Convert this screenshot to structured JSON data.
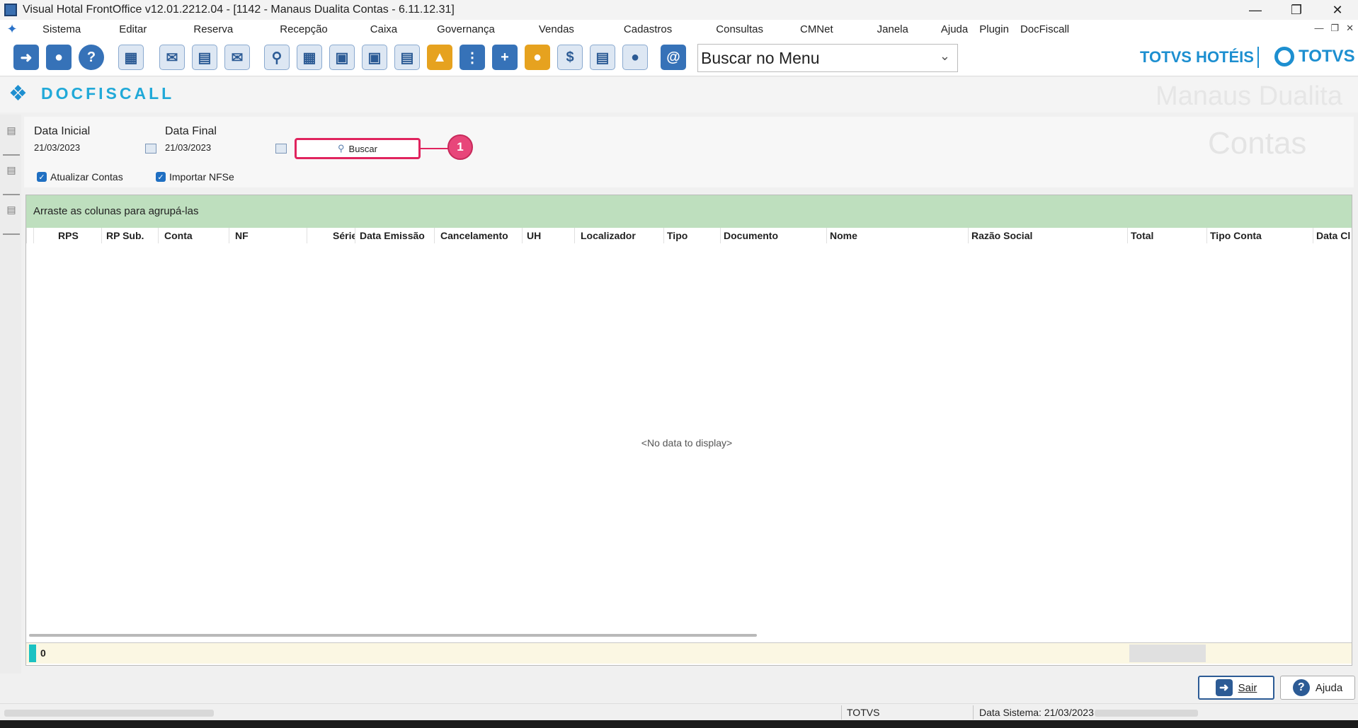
{
  "window": {
    "title": "Visual Hotal FrontOffice v12.01.2212.04 - [1142 - Manaus Dualita Contas - 6.11.12.31]"
  },
  "menu": [
    "Sistema",
    "Editar",
    "Reserva",
    "Recepção",
    "Caixa",
    "Governança",
    "Vendas",
    "Cadastros",
    "Consultas",
    "CMNet",
    "Janela",
    "Ajuda",
    "Plugin",
    "DocFiscall"
  ],
  "toolbar": {
    "search_placeholder": "Buscar no Menu",
    "brand_hoteis": "TOTVS HOTÉIS",
    "brand_totvs": "TOTVS",
    "icons": [
      "exit-icon",
      "user-key-icon",
      "help-icon",
      "network-icon",
      "mail-icon",
      "checklist-icon",
      "send-mail-icon",
      "search-icon",
      "calendar-icon",
      "guest-card-icon",
      "room-card-icon",
      "report-user-icon",
      "bell-icon",
      "footsteps-icon",
      "add-guest-icon",
      "housekeeping-icon",
      "cash-icon",
      "printer-icon",
      "concierge-icon",
      "email-at-icon"
    ]
  },
  "header": {
    "module": "DOCFISCALL",
    "watermark_top": "Manaus Dualita",
    "watermark_bottom": "Contas"
  },
  "form": {
    "data_inicial_label": "Data Inicial",
    "data_inicial": "21/03/2023",
    "data_final_label": "Data Final",
    "data_final": "21/03/2023",
    "buscar_label": "Buscar",
    "callout_number": "1",
    "atualizar_contas": "Atualizar Contas",
    "importar_nfse": "Importar NFSe"
  },
  "grid": {
    "group_hint": "Arraste as colunas para agrupá-las",
    "columns": [
      "RPS",
      "RP Sub.",
      "Conta",
      "NF",
      "Série",
      "Data Emissão",
      "Cancelamento",
      "UH",
      "Localizador",
      "Tipo",
      "Documento",
      "Nome",
      "Razão Social",
      "Total",
      "Tipo Conta",
      "Data Cl"
    ],
    "empty_text": "<No data to display>",
    "row_count": "0"
  },
  "buttons": {
    "sair": "Sair",
    "ajuda": "Ajuda"
  },
  "status": {
    "vendor": "TOTVS",
    "data_sistema": "Data Sistema: 21/03/2023"
  },
  "colors": {
    "accent": "#1d8fd0",
    "callout": "#e0245e",
    "group_bar": "#bedfbe",
    "checkbox": "#1f6fc2"
  }
}
